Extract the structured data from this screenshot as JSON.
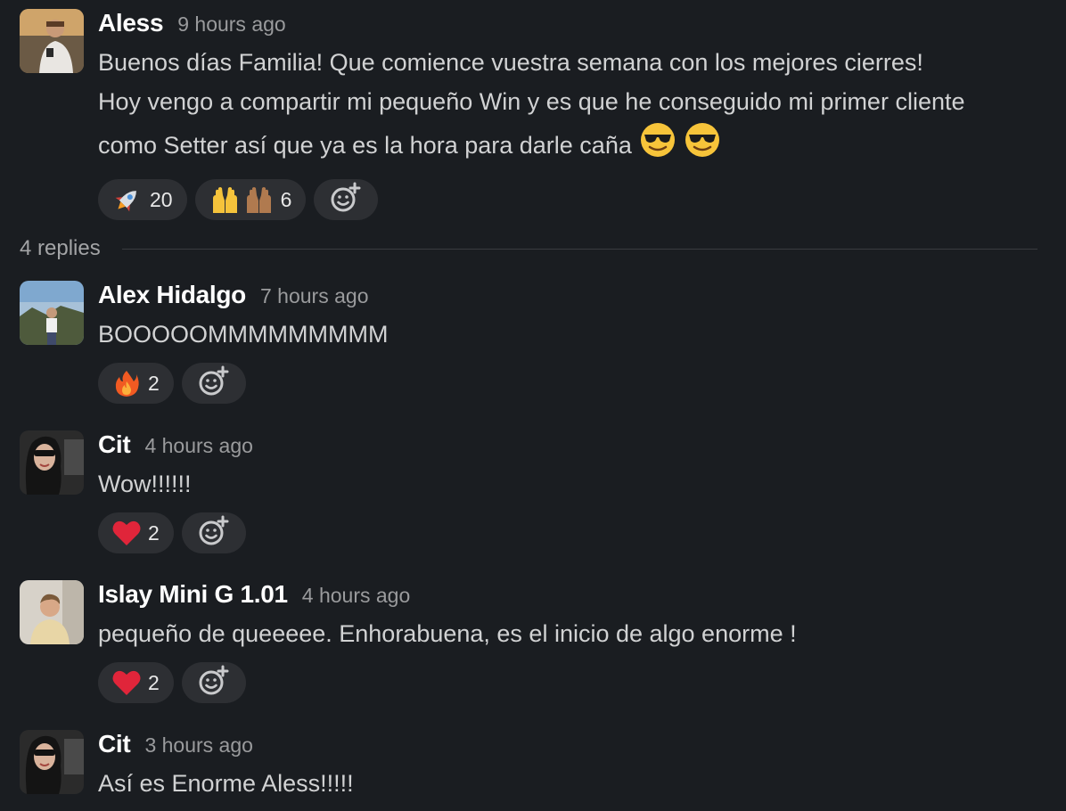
{
  "messages": [
    {
      "author": "Aless",
      "time": "9 hours ago",
      "lines": [
        "Buenos días Familia! Que comience vuestra semana con los mejores cierres!",
        "Hoy vengo a compartir mi pequeño Win y es que he conseguido mi primer cliente",
        "como Setter así que ya es la hora para darle caña"
      ],
      "trailing_emojis": [
        "sunglasses-emoji",
        "sunglasses-emoji"
      ],
      "reactions": [
        {
          "emoji": "rocket-emoji",
          "count": "20"
        },
        {
          "emoji": "raised-hands-emoji",
          "count": "6"
        }
      ]
    },
    {
      "author": "Alex Hidalgo",
      "time": "7 hours ago",
      "lines": [
        "BOOOOOMMMMMMMMM"
      ],
      "reactions": [
        {
          "emoji": "fire-emoji",
          "count": "2"
        }
      ]
    },
    {
      "author": "Cit",
      "time": "4 hours ago",
      "lines": [
        "Wow!!!!!!"
      ],
      "reactions": [
        {
          "emoji": "red-heart-emoji",
          "count": "2"
        }
      ]
    },
    {
      "author": "Islay Mini G 1.01",
      "time": "4 hours ago",
      "lines": [
        "pequeño de queeeee. Enhorabuena, es el inicio de algo enorme !"
      ],
      "reactions": [
        {
          "emoji": "red-heart-emoji",
          "count": "2"
        }
      ]
    },
    {
      "author": "Cit",
      "time": "3 hours ago",
      "lines": [
        "Así es Enorme Aless!!!!!"
      ],
      "reactions": []
    }
  ],
  "thread": {
    "replies_label": "4 replies"
  },
  "colors": {
    "background": "#1a1d21",
    "author": "#ffffff",
    "body_text": "#d1d2d3",
    "timestamp": "#9a9b9d",
    "reaction_pill": "#2d2f33"
  }
}
